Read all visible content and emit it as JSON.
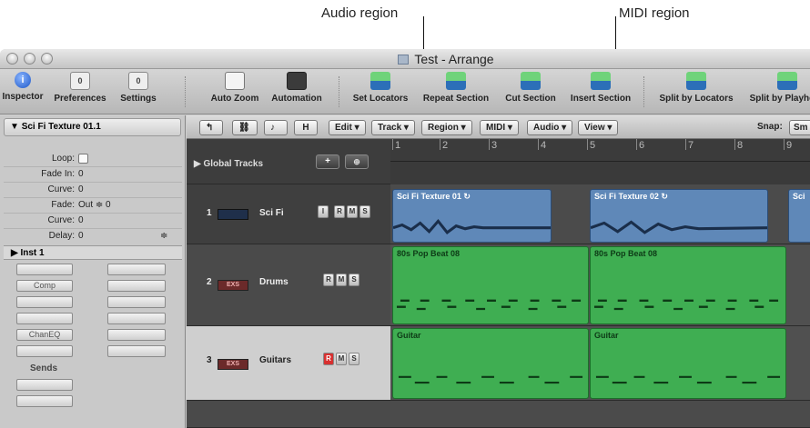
{
  "callouts": {
    "audio": "Audio region",
    "midi": "MIDI region"
  },
  "window": {
    "title": "Test - Arrange"
  },
  "toolbar": {
    "items": [
      "Inspector",
      "Preferences",
      "Settings",
      "Auto Zoom",
      "Automation",
      "Set Locators",
      "Repeat Section",
      "Cut Section",
      "Insert Section",
      "Split by Locators",
      "Split by Playhead"
    ],
    "icons": [
      "info-icon",
      "preferences-icon",
      "settings-icon",
      "auto-zoom-icon",
      "automation-icon",
      "set-locators-icon",
      "repeat-section-icon",
      "cut-section-icon",
      "insert-section-icon",
      "split-by-locators-icon",
      "split-by-playhead-icon"
    ],
    "pref_badge": "0",
    "settings_badge": "0"
  },
  "inspector": {
    "region_name": "Sci Fi Texture 01.1",
    "params": [
      {
        "label": "Loop:",
        "value": ""
      },
      {
        "label": "Fade In:",
        "value": "0"
      },
      {
        "label": "Curve:",
        "value": "0"
      },
      {
        "label": "Fade:",
        "value": "Out  ≑ 0"
      },
      {
        "label": "Curve:",
        "value": "0"
      },
      {
        "label": "Delay:",
        "value": "0"
      }
    ],
    "inst_label": "Inst 1",
    "slots": [
      "Comp",
      "ChanEQ"
    ],
    "sends_label": "Sends"
  },
  "arrange_toolbar": {
    "tool_h": "H",
    "menus": [
      "Edit",
      "Track",
      "Region",
      "MIDI",
      "Audio",
      "View"
    ],
    "snap_label": "Snap:",
    "snap_value": "Sm"
  },
  "global_tracks": {
    "label": "Global Tracks"
  },
  "ruler": {
    "bars": [
      "1",
      "2",
      "3",
      "4",
      "5",
      "6",
      "7",
      "8",
      "9"
    ]
  },
  "tracks": [
    {
      "num": "1",
      "name": "Sci Fi",
      "buttons": [
        "I",
        "R",
        "M",
        "S"
      ]
    },
    {
      "num": "2",
      "name": "Drums",
      "buttons": [
        "R",
        "M",
        "S"
      ]
    },
    {
      "num": "3",
      "name": "Guitars",
      "buttons": [
        "R",
        "M",
        "S"
      ]
    }
  ],
  "regions": {
    "audio": [
      "Sci Fi Texture 01 ↻",
      "Sci Fi Texture 02 ↻",
      "Sci"
    ],
    "drums": [
      "80s Pop Beat 08",
      "80s Pop Beat 08"
    ],
    "guitar": [
      "Guitar",
      "Guitar"
    ]
  },
  "colors": {
    "audio_region": "#5f88b8",
    "midi_region": "#3fae52",
    "record_red": "#d83030"
  }
}
